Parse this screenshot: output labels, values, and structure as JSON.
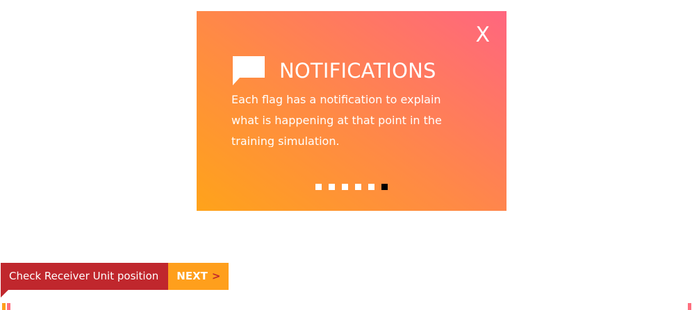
{
  "modal": {
    "close_label": "X",
    "title": "NOTIFICATIONS",
    "body": "Each flag has a notification to explain what is happening at that point in the training simulation.",
    "pager": {
      "total": 6,
      "active_index": 5
    },
    "colors": {
      "gradient_start": "#ffa31a",
      "gradient_end": "#ff667f",
      "text": "#ffffff"
    },
    "icon": "speech-bubble-icon"
  },
  "step_bar": {
    "step_label": "Check Receiver Unit position",
    "next_label": "NEXT",
    "next_arrow": ">",
    "colors": {
      "flag": "#c0272d",
      "next": "#ff9f1c"
    }
  }
}
